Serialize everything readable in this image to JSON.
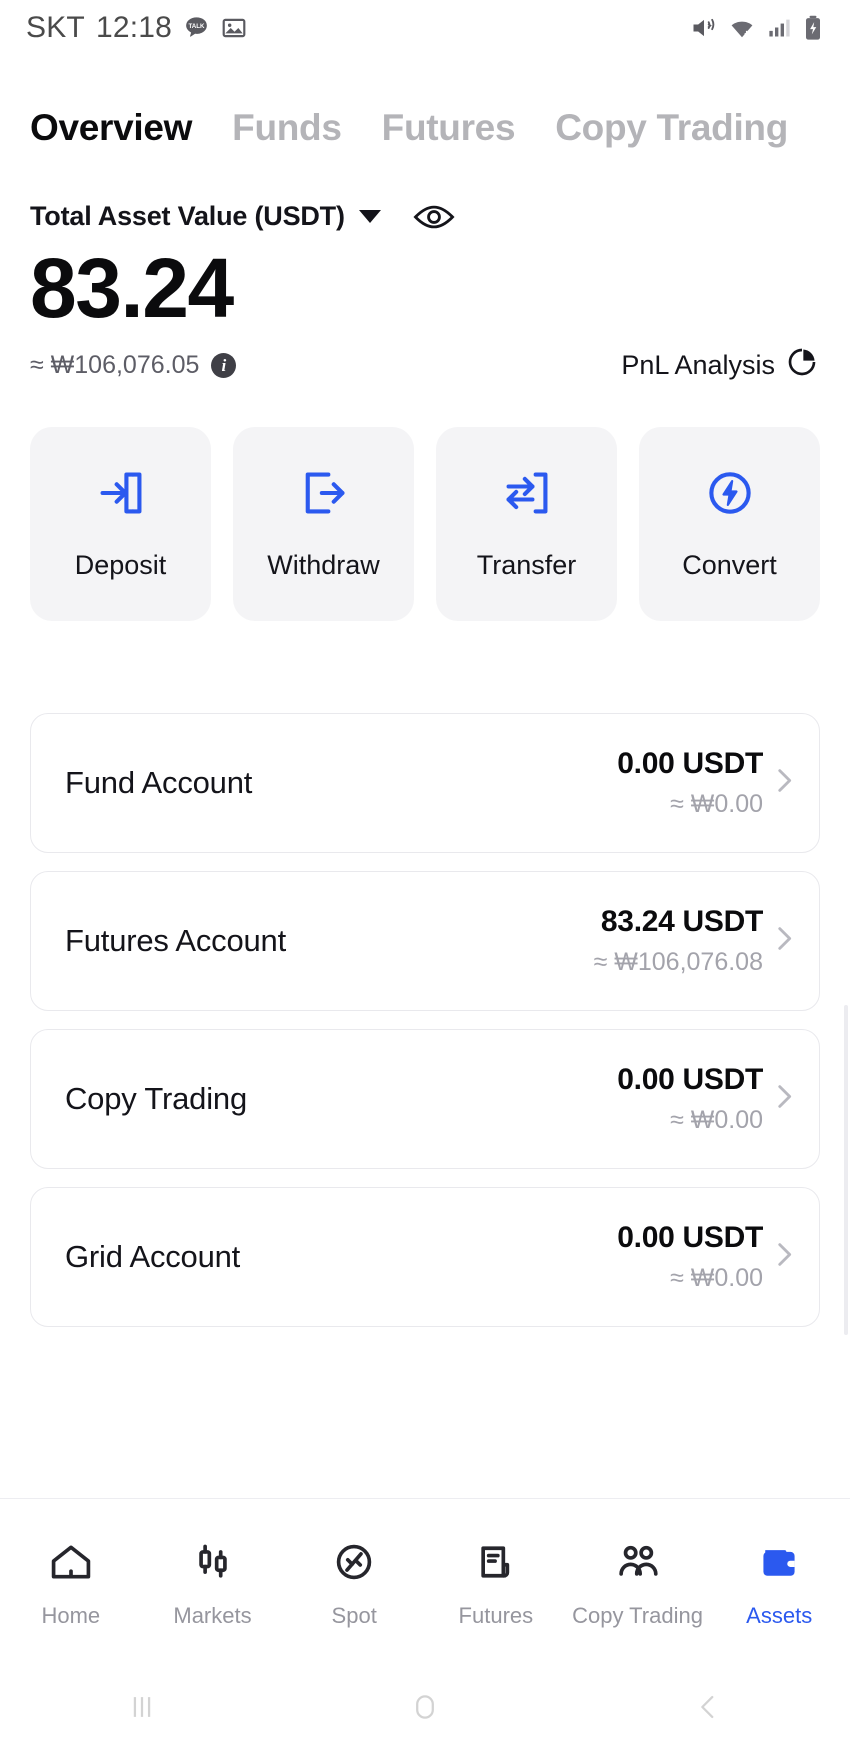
{
  "statusbar": {
    "carrier": "SKT",
    "time": "12:18",
    "left_icons": [
      "kakaotalk-icon",
      "gallery-icon"
    ],
    "right_icons": [
      "mute-vibrate-icon",
      "wifi-icon",
      "cellular-signal-icon",
      "battery-charging-icon"
    ]
  },
  "tabs": [
    {
      "label": "Overview",
      "active": true
    },
    {
      "label": "Funds",
      "active": false
    },
    {
      "label": "Futures",
      "active": false
    },
    {
      "label": "Copy Trading",
      "active": false
    }
  ],
  "balance": {
    "label": "Total Asset Value (USDT)",
    "amount": "83.24",
    "fiat_approx": "≈ ₩106,076.05",
    "info_glyph": "i",
    "pnl_label": "PnL Analysis"
  },
  "actions": [
    {
      "label": "Deposit",
      "icon": "deposit-arrow-in-icon"
    },
    {
      "label": "Withdraw",
      "icon": "withdraw-arrow-out-icon"
    },
    {
      "label": "Transfer",
      "icon": "transfer-arrows-icon"
    },
    {
      "label": "Convert",
      "icon": "convert-bolt-icon"
    }
  ],
  "accounts": [
    {
      "name": "Fund Account",
      "usdt": "0.00 USDT",
      "krw": "≈ ₩0.00"
    },
    {
      "name": "Futures Account",
      "usdt": "83.24 USDT",
      "krw": "≈ ₩106,076.08"
    },
    {
      "name": "Copy Trading",
      "usdt": "0.00 USDT",
      "krw": "≈ ₩0.00"
    },
    {
      "name": "Grid Account",
      "usdt": "0.00 USDT",
      "krw": "≈ ₩0.00"
    }
  ],
  "bottom_nav": [
    {
      "label": "Home",
      "icon": "home-icon",
      "active": false
    },
    {
      "label": "Markets",
      "icon": "candlestick-icon",
      "active": false
    },
    {
      "label": "Spot",
      "icon": "spot-circle-icon",
      "active": false
    },
    {
      "label": "Futures",
      "icon": "document-icon",
      "active": false
    },
    {
      "label": "Copy Trading",
      "icon": "people-icon",
      "active": false
    },
    {
      "label": "Assets",
      "icon": "wallet-icon",
      "active": true
    }
  ],
  "system_nav": [
    "recents-icon",
    "home-pill-icon",
    "back-icon"
  ],
  "colors": {
    "accent": "#2b59ef",
    "text": "#14141a",
    "muted": "#a3a3ab",
    "tile_bg": "#f4f4f6"
  }
}
